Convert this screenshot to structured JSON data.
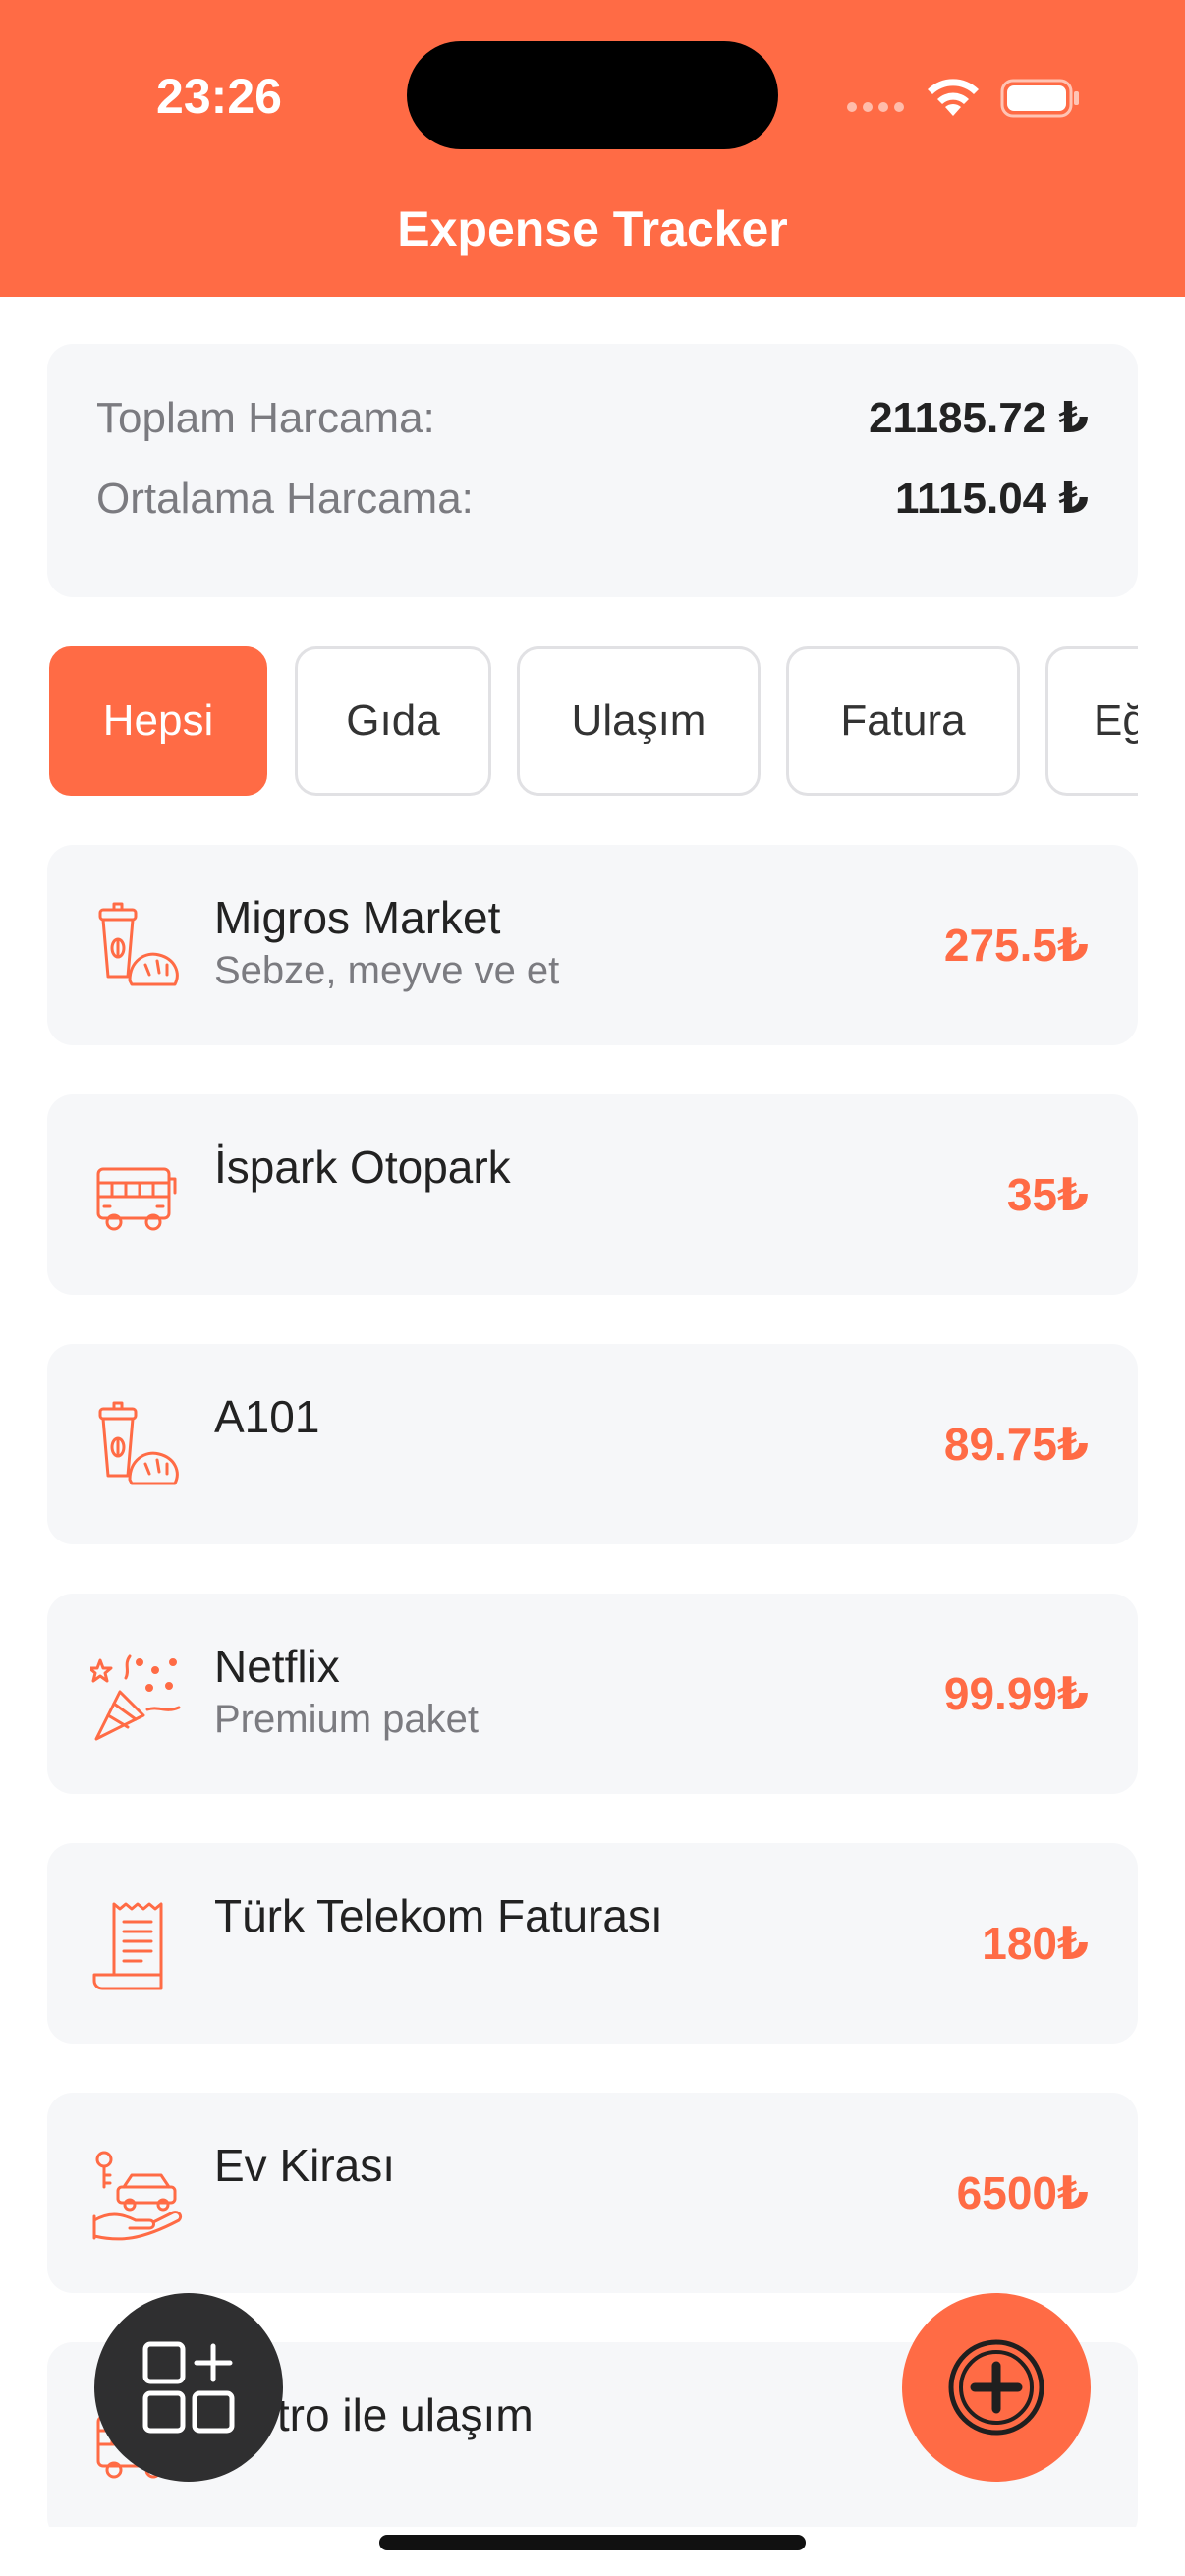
{
  "status_bar": {
    "time": "23:26"
  },
  "header": {
    "title": "Expense Tracker"
  },
  "summary": {
    "total_label": "Toplam Harcama:",
    "total_value": "21185.72 ₺",
    "average_label": "Ortalama Harcama:",
    "average_value": "1115.04 ₺"
  },
  "filters": {
    "chips": [
      "Hepsi",
      "Gıda",
      "Ulaşım",
      "Fatura",
      "Eğ"
    ],
    "selected": "Hepsi"
  },
  "expenses": [
    {
      "title": "Migros Market",
      "subtitle": "Sebze, meyve ve et",
      "amount": "275.5₺",
      "icon": "food-icon"
    },
    {
      "title": "İspark Otopark",
      "subtitle": "",
      "amount": "35₺",
      "icon": "bus-icon"
    },
    {
      "title": "A101",
      "subtitle": "",
      "amount": "89.75₺",
      "icon": "food-icon"
    },
    {
      "title": "Netflix",
      "subtitle": "Premium paket",
      "amount": "99.99₺",
      "icon": "party-icon"
    },
    {
      "title": "Türk Telekom Faturası",
      "subtitle": "",
      "amount": "180₺",
      "icon": "receipt-icon"
    },
    {
      "title": "Ev Kirası",
      "subtitle": "",
      "amount": "6500₺",
      "icon": "rent-icon"
    },
    {
      "title": "Metro ile ulaşım",
      "subtitle": "",
      "amount": "",
      "icon": "bus-icon"
    }
  ],
  "colors": {
    "accent": "#FF6B45",
    "card_bg": "#F6F7F9",
    "fab_dark": "#2F2F30"
  }
}
